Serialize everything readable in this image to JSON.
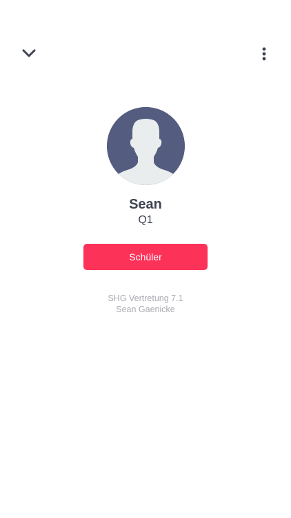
{
  "header": {
    "collapse_icon": "chevron-down-icon",
    "more_icon": "more-vertical-icon"
  },
  "profile": {
    "avatar_icon": "user-silhouette-icon",
    "name": "Sean",
    "grade": "Q1",
    "role_label": "Schüler",
    "app_info": "SHG Vertretung 7.1",
    "full_name": "Sean Gaenicke"
  },
  "colors": {
    "accent": "#fc3259",
    "avatar_background": "#545d80",
    "avatar_silhouette": "#e9edee",
    "text_primary": "#3e4350",
    "text_muted": "#a8aab0"
  }
}
